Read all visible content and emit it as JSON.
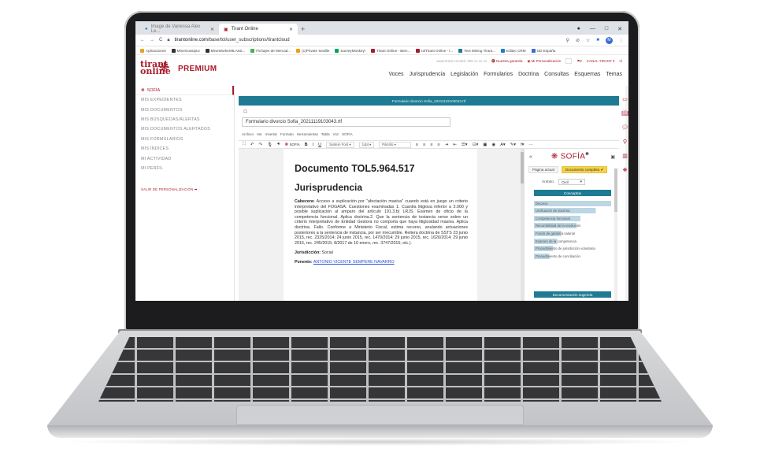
{
  "browser": {
    "tabs": [
      {
        "label": "Image de Vanessa Alex Le..."
      },
      {
        "label": "Tirant Online"
      }
    ],
    "new_tab": "+",
    "window_controls": [
      "—",
      "□",
      "✕"
    ],
    "url_prefix": "tirantonline.com",
    "url_path": "/base/tol/user_subscriptions/tirantcloud",
    "profile_initial": "M",
    "bookmarks": [
      {
        "label": "Aplicaciones",
        "color": "#e8a31f"
      },
      {
        "label": "MineGossipUI",
        "color": "#333333"
      },
      {
        "label": "MineWorkerMLAssi...",
        "color": "#333333"
      },
      {
        "label": "Fichajes de Mercad...",
        "color": "#4caf50"
      },
      {
        "label": "(1)Private Seafile",
        "color": "#f0a000"
      },
      {
        "label": "SurveyMonkey!",
        "color": "#00a75a"
      },
      {
        "label": "Tirant Online - Bien...",
        "color": "#a81c2c"
      },
      {
        "label": "tolTirant Online - l...",
        "color": "#a81c2c"
      },
      {
        "label": "Text Mining Tirant...",
        "color": "#1e7b93"
      },
      {
        "label": "Editec CRM",
        "color": "#1e7bd6"
      },
      {
        "label": "GD España",
        "color": "#3c6ad7"
      }
    ]
  },
  "site": {
    "logo_line1": "tirant",
    "logo_line2": "online",
    "premium": "PREMIUM",
    "top_links": {
      "faint": "www.tirant.com/tol: 900 xx xx xx",
      "garantia": "Nuestra garantía",
      "personalizacion": "Mi Personalización",
      "user": "CANAL TIRANT"
    },
    "nav": [
      "Voces",
      "Jurisprudencia",
      "Legislación",
      "Formularios",
      "Doctrina",
      "Consultas",
      "Esquemas",
      "Temas"
    ]
  },
  "sidebar": {
    "sofia": "SOFÍA",
    "items": [
      "MIS EXPEDIENTES",
      "MIS DOCUMENTOS",
      "MIS BÚSQUEDAS/ALERTAS",
      "MIS DOCUMENTOS ALERTADOS",
      "MIS FORMULARIOS",
      "MIS ÍNDICES",
      "MI ACTIVIDAD",
      "MI PERFIL"
    ],
    "exit": "SALIR DE PERSONALIZACIÓN"
  },
  "editor": {
    "banner": "Formulario divorcio Sofia_20211119103043.rtf",
    "filename": "Formulario divorcio Sofia_20211119103043.rtf",
    "menu": [
      "Archivo",
      "Ver",
      "Insertar",
      "Formato",
      "Herramientas",
      "Tabla",
      "Voz",
      "SOFÍA"
    ],
    "font_select": "System Font",
    "size_select": "14pt",
    "style_select": "Párrafo",
    "doc_title": "Documento TOL5.964.517",
    "doc_subtitle": "Jurisprudencia",
    "cabecera_label": "Cabecera:",
    "cabecera_text": "Acceso a suplicación por \"afectación masiva\" cuando está en juego un criterio interpretativo del FOGASA. Cuestiones examinadas 1. Cuantía litigiosa inferior a 3.000 y posible suplicación al amparo del artículo 191.3.b) LRJS. Examen de oficio de la competencia funcional. Aplica doctrina.2. Que la sentencia de instancia verse sobre un criterio interpretativo de Entidad Gestora no comporta que haya litigiosidad masiva. Aplica doctrina. Fallo. Conforme a Ministerio Fiscal, estima recurso, anulando actuaciones posteriores a la sentencia de instancia, por ser irrecurrible. Reitera doctrina de SSTS 23 junio 2015, rec. 2325/2014; 24 junio 2015, rec. 1470/2014; 29 junio 2015, rec. 1626/2014; 29 junio 2016, rec. 245/2015; 8/2017 de 10 enero, rec. 3747/2015; etc.).",
    "jurisdiccion_label": "Jurisdicción:",
    "jurisdiccion_value": "Social",
    "ponente_label": "Ponente:",
    "ponente_value": "ANTONIO VICENTE SEMPERE NAVARRO"
  },
  "sofia_panel": {
    "title": "SOFÍA",
    "btn_page": "Página actual",
    "btn_doc": "Documento completo",
    "ambito_label": "Ámbito",
    "ambito_value": "Civil",
    "conceptos_header": "Conceptos",
    "conceptos": [
      {
        "label": "Divorcio",
        "relevance": 1.0
      },
      {
        "label": "Unificación de doctrina",
        "relevance": 0.8
      },
      {
        "label": "Competencia funcional",
        "relevance": 0.6
      },
      {
        "label": "Recurribilidad de la resolución",
        "relevance": 0.55
      },
      {
        "label": "Fondo de garantía salarial",
        "relevance": 0.35
      },
      {
        "label": "Examen de la competencia",
        "relevance": 0.3
      },
      {
        "label": "Procedimiento de jurisdicción voluntaria",
        "relevance": 0.25
      },
      {
        "label": "Procedimiento de conciliación",
        "relevance": 0.2
      }
    ],
    "doc_sugerida": "Documentación sugerida",
    "small_left": "Doctr. Gestor",
    "small_right": "Ciudat Mester"
  },
  "colors": {
    "brand": "#a81c2c",
    "teal": "#1e7b93",
    "highlight": "#f4d24a"
  }
}
